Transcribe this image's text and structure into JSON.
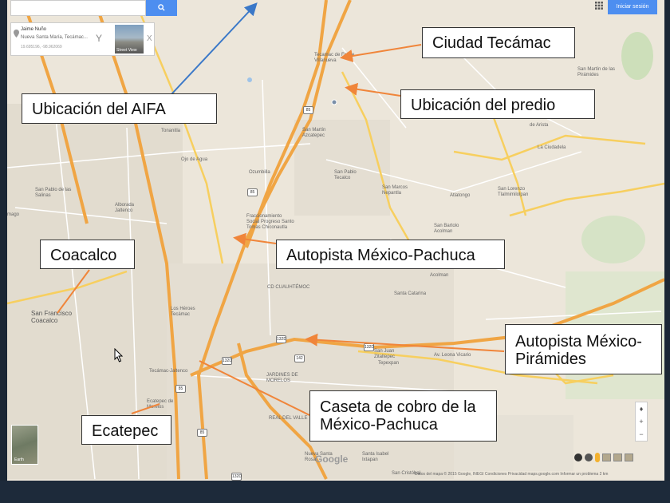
{
  "search": {
    "placeholder": ""
  },
  "info_card": {
    "name": "Jaime Nuño",
    "address": "Nueva Santa María, Tecámac...",
    "coords": "19.695196, -98.962069",
    "thumb_label": "Street View",
    "close": "X"
  },
  "header": {
    "signin_label": "Iniciar sesión"
  },
  "callouts": {
    "aifa": "Ubicación del AIFA",
    "tecamac": "Ciudad Tecámac",
    "predio": "Ubicación del predio",
    "coacalco": "Coacalco",
    "mex_pachuca": "Autopista México-Pachuca",
    "mex_piramides": "Autopista México-Pirámides",
    "caseta": "Caseta de cobro de la México-Pachuca",
    "ecatepec": "Ecatepec"
  },
  "map_labels": {
    "tecamac_felipe": "Tecamac de Felipe Villanueva",
    "san_martin_azcatepec": "San Martín Azcatepec",
    "ojo_de_agua": "Ojo de Agua",
    "ozumbilla": "Ozumbilla",
    "san_pablo_tecalco": "San Pablo Tecalco",
    "san_marcos_nepantla": "San Marcos Nepantla",
    "atlatongo": "Atlatongo",
    "san_lorenzo": "San Lorenzo Tlalmimilolpan",
    "san_bartolo": "San Bartolo Acolman",
    "acolman": "Acolman",
    "fraccionamiento": "Fraccionamiento Social Progreso Santo Tomas Chiconautla",
    "san_pablo_salinas": "San Pablo de las Salinas",
    "alborada": "Alborada Jaltenco",
    "san_francisco_coacalco": "San Francisco Coacalco",
    "los_heroes": "Los Héroes Tecámac",
    "ecatepec_morelos": "Ecatepec de Morelos",
    "san_juan_zitaltepec": "San Juan Zitaltepec",
    "tepexpan": "Tepexpan",
    "santa_catarina": "Santa Catarina",
    "la_ciudadela": "La Ciudadela",
    "san_martin_piramides": "San Martín de las Pirámides",
    "real_del_valle": "REAL DEL VALLE",
    "nueva_santa_rosa": "Nueva Santa Rosa",
    "santa_isabel": "Santa Isabel Ixtapan",
    "san_cristobal": "San Cristóbal",
    "tonanitla": "Tonanitla",
    "amago": "mago",
    "arista": "de Arista",
    "cd_cuauhtemoc": "CD CUAUHTÉMOC",
    "jardines_morelos": "JARDINES DE MORELOS",
    "tecamac_hwy": "Tecámac-Jaltenco",
    "el_sol": "Av. Leona Vicario"
  },
  "shields": [
    "85",
    "85",
    "85",
    "85",
    "132D",
    "132D",
    "132D",
    "142",
    "132D"
  ],
  "earth_label": "Earth",
  "google_logo": "Google",
  "attribution": "Datos del mapa © 2015 Google, INEGI   Condiciones   Privacidad   maps.google.com   Informar un problema   2 km",
  "colors": {
    "map_bg": "#ece6da",
    "highway": "#f0a544",
    "arrow_orange": "#f0853a",
    "arrow_blue": "#3a78c8",
    "button_blue": "#4d8ef0"
  }
}
